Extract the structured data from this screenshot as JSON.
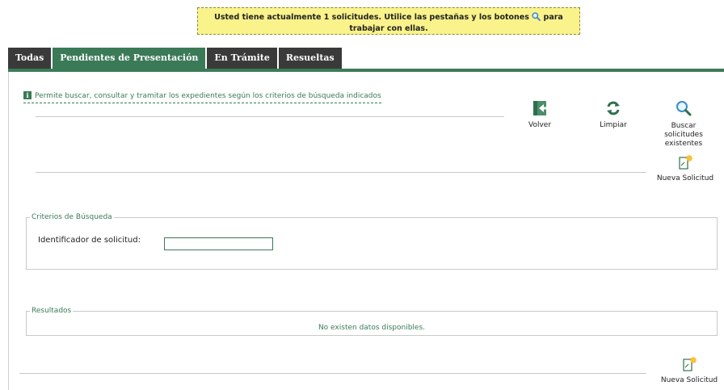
{
  "notice": {
    "text_before": "Usted tiene actualmente 1 solicitudes. Utilice las pestañas y los botones",
    "text_after_icon": "para",
    "text_line2": "trabajar con ellas.",
    "icon": "search-icon"
  },
  "tabs": [
    {
      "label": "Todas",
      "active": false
    },
    {
      "label": "Pendientes de Presentación",
      "active": true
    },
    {
      "label": "En Trámite",
      "active": false
    },
    {
      "label": "Resueltas",
      "active": false
    }
  ],
  "info": {
    "icon": "info-icon",
    "text": "Permite buscar, consultar y tramitar los expedientes según los criterios de búsqueda indicados"
  },
  "toolbar": {
    "volver_label": "Volver",
    "limpiar_label": "Limpiar",
    "buscar_line1": "Buscar",
    "buscar_line2": "solicitudes",
    "buscar_line3": "existentes",
    "nueva_top_label": "Nueva Solicitud",
    "nueva_bottom_label": "Nueva Solicitud"
  },
  "criterios": {
    "legend": "Criterios de Búsqueda",
    "id_label": "Identificador de solicitud:",
    "id_value": "",
    "id_placeholder": ""
  },
  "resultados": {
    "legend": "Resultados",
    "empty_message": "No existen datos disponibles."
  },
  "colors": {
    "accent": "#3b7a57",
    "tab_inactive": "#3a3a3a",
    "notice_bg": "#faf28a"
  }
}
